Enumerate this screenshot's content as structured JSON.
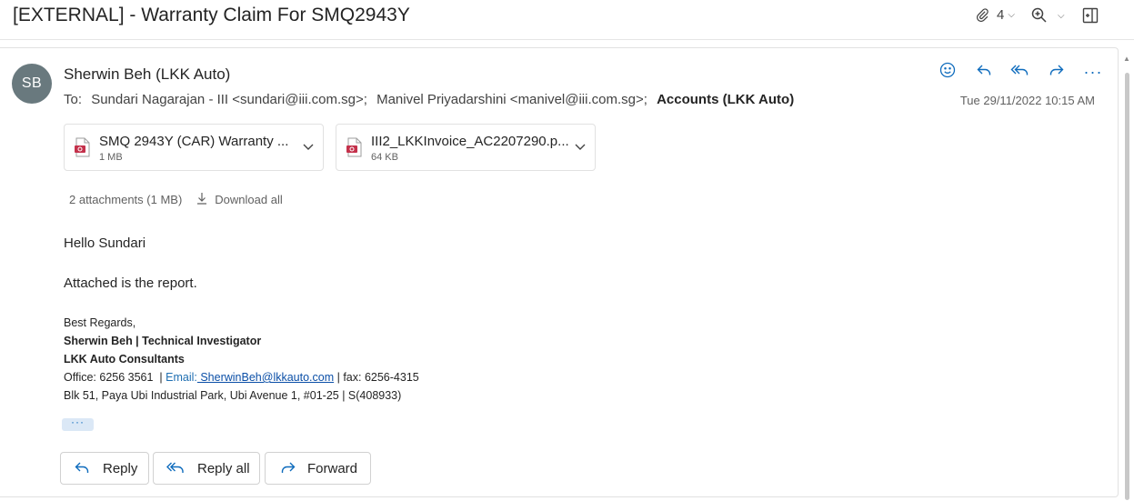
{
  "subject": "[EXTERNAL] - Warranty Claim For SMQ2943Y",
  "toolbar": {
    "attachment_count": "4",
    "attachment_icon": "paperclip-icon",
    "zoom_icon": "zoom-in-icon",
    "popout_icon": "open-in-new-window-icon"
  },
  "message": {
    "avatar_initials": "SB",
    "avatar_color": "#69797e",
    "sender": "Sherwin Beh (LKK Auto)",
    "to_label": "To:",
    "recipients": [
      "Sundari Nagarajan - III <sundari@iii.com.sg>;",
      "Manivel Priyadarshini <manivel@iii.com.sg>;",
      "Accounts (LKK Auto)"
    ],
    "date": "Tue 29/11/2022 10:15 AM",
    "actions": [
      "emoji-icon",
      "reply-icon",
      "reply-all-icon",
      "forward-icon",
      "more-icon"
    ]
  },
  "attachments": [
    {
      "name": "SMQ 2943Y (CAR) Warranty ...",
      "size": "1 MB",
      "type": "pdf"
    },
    {
      "name": "III2_LKKInvoice_AC2207290.p...",
      "size": "64 KB",
      "type": "pdf"
    }
  ],
  "attachment_summary": {
    "text": "2 attachments (1 MB)",
    "download_all": "Download all"
  },
  "body": {
    "greeting": "Hello Sundari",
    "line1": "Attached is the report."
  },
  "signature": {
    "regards": "Best Regards,",
    "name_title": "Sherwin Beh | Technical Investigator",
    "company": "LKK Auto Consultants",
    "office": "Office: 6256 3561",
    "separator1": "  | ",
    "email_label": "Email:",
    "email": " SherwinBeh@lkkauto.com",
    "fax": " | fax: 6256-4315",
    "address": "Blk 51, Paya Ubi Industrial Park, Ubi Avenue 1, #01-25 | S(408933)"
  },
  "show_more": "···",
  "footer_buttons": {
    "reply": "Reply",
    "reply_all": "Reply all",
    "forward": "Forward"
  },
  "colors": {
    "accent": "#0f6cbd",
    "pdf_red": "#c4314b"
  }
}
